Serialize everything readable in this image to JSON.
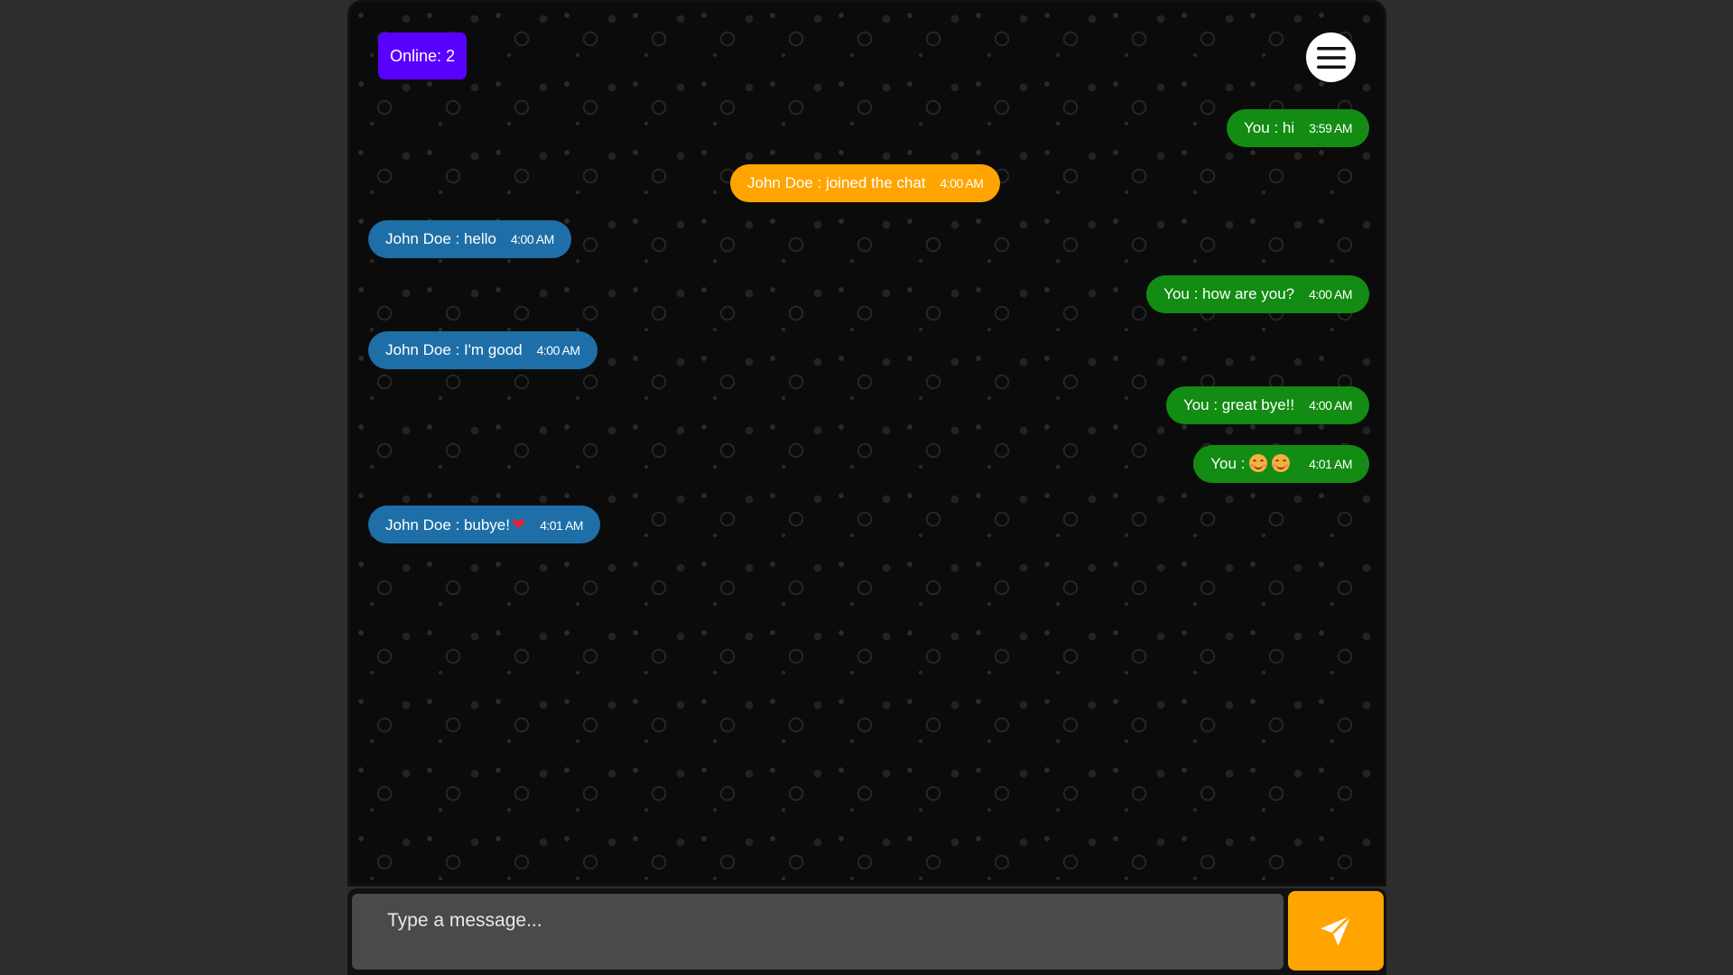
{
  "header": {
    "online_label": "Online: 2"
  },
  "icons": {
    "menu": "hamburger-menu-icon",
    "send": "paper-plane-icon"
  },
  "messages": [
    {
      "type": "self",
      "text": "You : hi",
      "time": "3:59 AM"
    },
    {
      "type": "system",
      "text": "John Doe : joined the chat",
      "time": "4:00 AM"
    },
    {
      "type": "other",
      "text": "John Doe : hello",
      "time": "4:00 AM"
    },
    {
      "type": "self",
      "text": "You : how are you?",
      "time": "4:00 AM"
    },
    {
      "type": "other",
      "text": "John Doe : I'm good",
      "time": "4:00 AM"
    },
    {
      "type": "self",
      "text": "You : great bye!!",
      "time": "4:00 AM"
    },
    {
      "type": "self",
      "text": "You :",
      "emoji": "smiling-face-emoji x2",
      "time": "4:01 AM"
    },
    {
      "type": "other",
      "text": "John Doe : bubye!",
      "emoji": "red-heart-emoji",
      "time": "4:01 AM"
    }
  ],
  "composer": {
    "placeholder": "Type a message..."
  },
  "colors": {
    "self_bubble": "#128c12",
    "other_bubble": "#1e6fa8",
    "system_bubble": "#ffa400",
    "online_badge": "#5a00ff",
    "send_button": "#ffa400"
  }
}
